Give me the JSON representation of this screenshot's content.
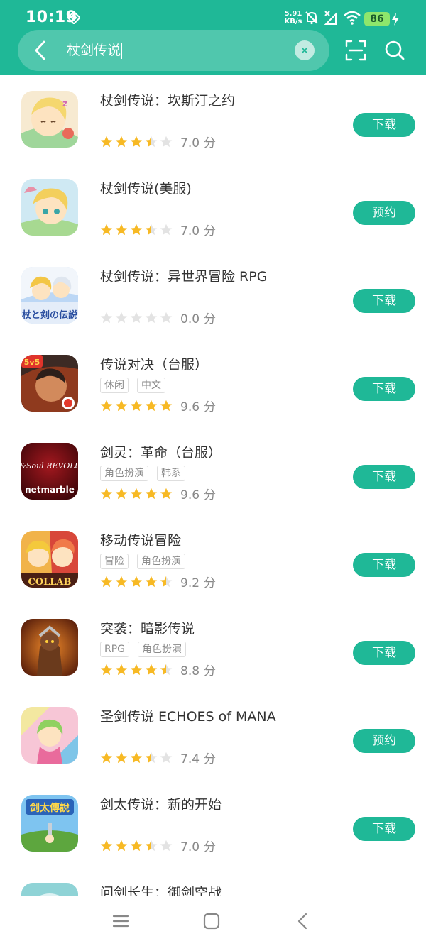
{
  "status_bar": {
    "time": "10:19",
    "net_speed_value": "5.91",
    "net_speed_unit": "KB/s",
    "battery": "86",
    "icons": [
      "diamond-icon",
      "bell-mute-icon",
      "signal-off-icon",
      "wifi-icon",
      "battery-icon",
      "charging-icon"
    ]
  },
  "search": {
    "query": "杖剑传说",
    "icons": [
      "back-arrow-icon",
      "clear-icon",
      "scan-icon",
      "search-icon"
    ]
  },
  "theme": {
    "accent": "#1fb897",
    "star_on": "#f7b924",
    "star_off": "#e3e3e3"
  },
  "apps": [
    {
      "name": "杖剑传说：坎斯汀之约",
      "tags": [],
      "stars": 3.5,
      "score": "7.0",
      "unit": "分",
      "action": "下载"
    },
    {
      "name": "杖剑传说(美服)",
      "tags": [],
      "stars": 3.5,
      "score": "7.0",
      "unit": "分",
      "action": "预约"
    },
    {
      "name": "杖剑传说：异世界冒险 RPG",
      "tags": [],
      "stars": 0,
      "score": "0.0",
      "unit": "分",
      "action": "下载"
    },
    {
      "name": "传说对决（台服）",
      "tags": [
        "休闲",
        "中文"
      ],
      "stars": 5,
      "score": "9.6",
      "unit": "分",
      "action": "下载"
    },
    {
      "name": "剑灵：革命（台服）",
      "tags": [
        "角色扮演",
        "韩系"
      ],
      "stars": 5,
      "score": "9.6",
      "unit": "分",
      "action": "下载"
    },
    {
      "name": "移动传说冒险",
      "tags": [
        "冒险",
        "角色扮演"
      ],
      "stars": 4.5,
      "score": "9.2",
      "unit": "分",
      "action": "下载"
    },
    {
      "name": "突袭：暗影传说",
      "tags": [
        "RPG",
        "角色扮演"
      ],
      "stars": 4.5,
      "score": "8.8",
      "unit": "分",
      "action": "下载"
    },
    {
      "name": "圣剑传说 ECHOES of MANA",
      "tags": [],
      "stars": 3.5,
      "score": "7.4",
      "unit": "分",
      "action": "预约"
    },
    {
      "name": "剑太传说：新的开始",
      "tags": [],
      "stars": 3.5,
      "score": "7.0",
      "unit": "分",
      "action": "下载"
    },
    {
      "name": "问剑长生：御剑空战",
      "tags": [],
      "stars": 0,
      "score": "",
      "unit": "",
      "action": ""
    }
  ],
  "icon_art": {
    "netmarble_wordmark": "netmarble",
    "collab_wordmark": "COLLAB",
    "bns_wordmark": "Blade&Soul REVOLUTION",
    "sv5_wordmark": "5v5",
    "rpg_icon_wordmark": "杖と剣の伝説",
    "jianta_wordmark": "剑太傳說"
  },
  "nav": {
    "icons": [
      "menu-icon",
      "home-icon",
      "back-icon"
    ]
  }
}
